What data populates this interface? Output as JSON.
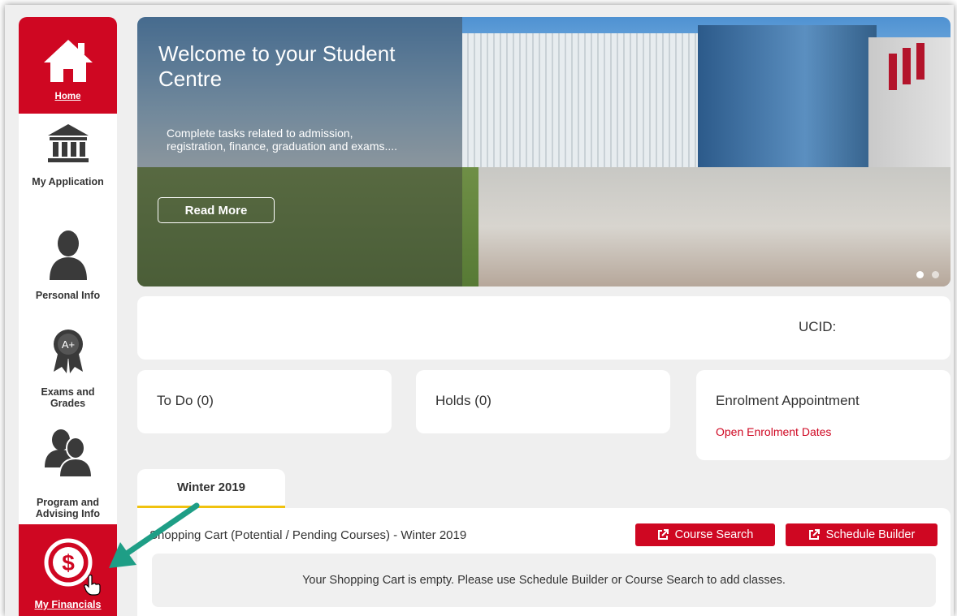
{
  "sidebar": {
    "items": [
      {
        "label": "Home",
        "icon": "home-icon",
        "active": true
      },
      {
        "label": "My Application",
        "icon": "institution-icon",
        "active": false
      },
      {
        "label": "Personal Info",
        "icon": "person-icon",
        "active": false
      },
      {
        "label": "Exams and Grades",
        "icon": "award-ribbon-icon",
        "badge": "A+",
        "active": false
      },
      {
        "label": "Program and Advising Info",
        "icon": "people-icon",
        "active": false
      },
      {
        "label": "My Financials",
        "icon": "dollar-icon",
        "active": true
      }
    ]
  },
  "hero": {
    "title": "Welcome to your Student Centre",
    "text": "Complete tasks related to admission, registration, finance, graduation and exams....",
    "button_label": "Read More",
    "carousel_dots": 2
  },
  "ucid": {
    "label": "UCID:"
  },
  "cards": {
    "todo": "To Do (0)",
    "holds": "Holds (0)",
    "enrolment_title": "Enrolment Appointment",
    "enrolment_link": "Open Enrolment Dates"
  },
  "term_tab": {
    "label": "Winter 2019"
  },
  "shopping_cart": {
    "title": "Shopping Cart (Potential / Pending Courses) - Winter 2019",
    "course_search_label": "Course Search",
    "schedule_builder_label": "Schedule Builder",
    "empty_message": "Your Shopping Cart is empty. Please use Schedule Builder or Course Search to add classes."
  },
  "colors": {
    "brand_red": "#cf0722",
    "tab_underline": "#f0c20f",
    "annotation_arrow": "#1e9e86",
    "background": "#efefef"
  }
}
